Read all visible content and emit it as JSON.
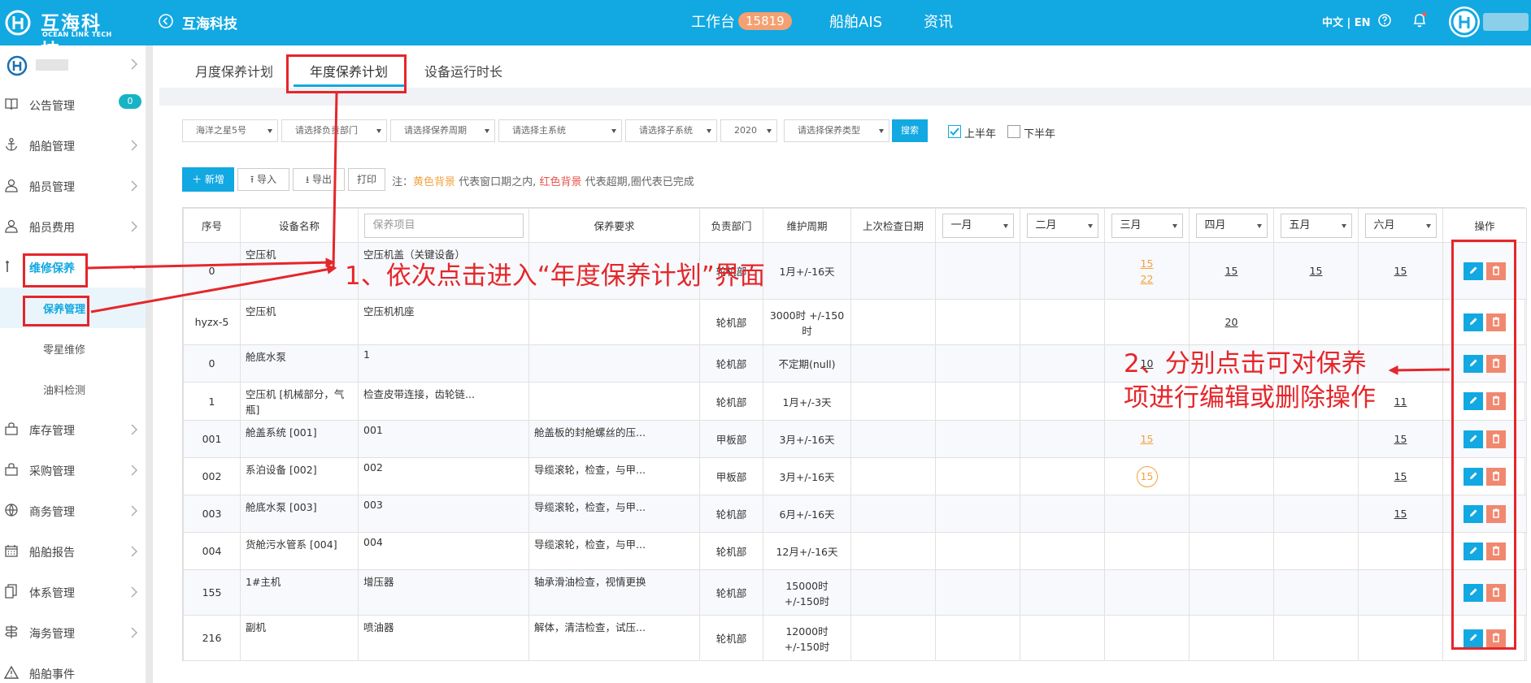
{
  "header": {
    "logo_name": "互海科技",
    "logo_sub": "OCEAN LINK TECH",
    "company_title": "互海科技",
    "nav": [
      {
        "label": "工作台",
        "badge": "15819"
      },
      {
        "label": "船舶AIS"
      },
      {
        "label": "资讯"
      }
    ],
    "lang": "中文 | EN"
  },
  "sidebar": {
    "items": [
      {
        "label": "公告管理",
        "icon": "book-icon",
        "badge": "0"
      },
      {
        "label": "船舶管理",
        "icon": "anchor-icon"
      },
      {
        "label": "船员管理",
        "icon": "person-icon"
      },
      {
        "label": "船员费用",
        "icon": "person-icon"
      },
      {
        "label": "维修保养",
        "icon": "wrench-icon",
        "active": true
      },
      {
        "label": "库存管理",
        "icon": "bag-icon"
      },
      {
        "label": "采购管理",
        "icon": "bag-icon"
      },
      {
        "label": "商务管理",
        "icon": "globe-icon"
      },
      {
        "label": "船舶报告",
        "icon": "calendar-icon"
      },
      {
        "label": "体系管理",
        "icon": "docs-icon"
      },
      {
        "label": "海务管理",
        "icon": "signpost-icon"
      },
      {
        "label": "船舶事件",
        "icon": "warning-icon"
      }
    ],
    "subitems": [
      {
        "label": "保养管理",
        "active": true
      },
      {
        "label": "零星维修"
      },
      {
        "label": "油料检测"
      }
    ]
  },
  "tabs": [
    {
      "label": "月度保养计划"
    },
    {
      "label": "年度保养计划",
      "active": true
    },
    {
      "label": "设备运行时长"
    }
  ],
  "filters": {
    "ship": "海洋之星5号",
    "dept_placeholder": "请选择负责部门",
    "cycle_placeholder": "请选择保养周期",
    "main_system_placeholder": "请选择主系统",
    "sub_system_placeholder": "请选择子系统",
    "year": "2020",
    "type_placeholder": "请选择保养类型",
    "search_label": "搜索",
    "first_half": {
      "label": "上半年",
      "checked": true
    },
    "second_half": {
      "label": "下半年",
      "checked": false
    }
  },
  "actions": {
    "add": "新增",
    "import": "导入",
    "export": "导出",
    "print": "打印",
    "note_prefix": "注：",
    "note_yellow": "黄色背景",
    "note_mid": " 代表窗口期之内, ",
    "note_red": "红色背景",
    "note_suffix": " 代表超期,圈代表已完成"
  },
  "table": {
    "headers": {
      "seq": "序号",
      "device": "设备名称",
      "item_placeholder": "保养项目",
      "requirement": "保养要求",
      "dept": "负责部门",
      "cycle": "维护周期",
      "last_check": "上次检查日期",
      "months": [
        "一月",
        "二月",
        "三月",
        "四月",
        "五月",
        "六月"
      ],
      "ops": "操作"
    },
    "rows": [
      {
        "seq": "0",
        "device": "空压机",
        "item": "空压机盖（关键设备）",
        "requirement": "",
        "dept": "轮机部",
        "cycle": "1月+/-16天",
        "last": "",
        "m3": [
          {
            "v": "15",
            "s": "orange"
          },
          {
            "v": "22",
            "s": "orange"
          }
        ],
        "m4": [
          {
            "v": "15"
          }
        ],
        "m5": [
          {
            "v": "15"
          }
        ],
        "m6": [
          {
            "v": "15"
          }
        ]
      },
      {
        "seq": "hyzx-5",
        "device": "空压机",
        "item": "空压机机座",
        "requirement": "",
        "dept": "轮机部",
        "cycle": "3000时 +/-150时",
        "last": "",
        "m4": [
          {
            "v": "20"
          }
        ]
      },
      {
        "seq": "0",
        "device": "舱底水泵",
        "item": "1",
        "requirement": "",
        "dept": "轮机部",
        "cycle": "不定期(null)",
        "last": "",
        "m3": [
          {
            "v": "10"
          }
        ]
      },
      {
        "seq": "1",
        "device": "空压机 [机械部分，气瓶]",
        "item": "检查皮带连接，齿轮链...",
        "requirement": "",
        "dept": "轮机部",
        "cycle": "1月+/-3天",
        "last": "",
        "m6": [
          {
            "v": "11"
          }
        ]
      },
      {
        "seq": "001",
        "device": "舱盖系统 [001]",
        "item": "001",
        "requirement": "舱盖板的封舱螺丝的压...",
        "dept": "甲板部",
        "cycle": "3月+/-16天",
        "last": "",
        "m3": [
          {
            "v": "15",
            "s": "orange"
          }
        ],
        "m6": [
          {
            "v": "15"
          }
        ]
      },
      {
        "seq": "002",
        "device": "系泊设备 [002]",
        "item": "002",
        "requirement": "导缆滚轮，检查，与甲...",
        "dept": "甲板部",
        "cycle": "3月+/-16天",
        "last": "",
        "m3": [
          {
            "v": "15",
            "s": "circle"
          }
        ],
        "m6": [
          {
            "v": "15"
          }
        ]
      },
      {
        "seq": "003",
        "device": "舱底水泵 [003]",
        "item": "003",
        "requirement": "导缆滚轮，检查，与甲...",
        "dept": "轮机部",
        "cycle": "6月+/-16天",
        "last": "",
        "m6": [
          {
            "v": "15"
          }
        ]
      },
      {
        "seq": "004",
        "device": "货舱污水管系 [004]",
        "item": "004",
        "requirement": "导缆滚轮，检查，与甲...",
        "dept": "轮机部",
        "cycle": "12月+/-16天",
        "last": ""
      },
      {
        "seq": "155",
        "device": "1#主机",
        "item": "增压器",
        "requirement": "轴承滑油检查，视情更换",
        "dept": "轮机部",
        "cycle": "15000时 +/-150时",
        "last": ""
      },
      {
        "seq": "216",
        "device": "副机",
        "item": "喷油器",
        "requirement": "解体，清洁检查，试压...",
        "dept": "轮机部",
        "cycle": "12000时 +/-150时",
        "last": ""
      }
    ]
  },
  "annotations": {
    "step1": "1、依次点击进入“年度保养计划”界面",
    "step2_line1": "2、分别点击可对保养",
    "step2_line2": "项进行编辑或删除操作"
  },
  "colors": {
    "primary": "#12a8e2",
    "annotation": "#e5262a",
    "orange": "#f3a23e",
    "badge": "#f4a072",
    "delete": "#f08870"
  }
}
